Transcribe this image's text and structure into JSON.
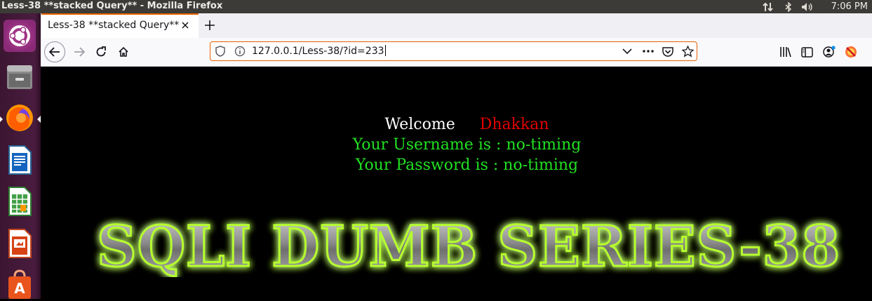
{
  "top_panel": {
    "window_title": "Less-38 **stacked Query** - Mozilla Firefox",
    "clock": "7:06 PM"
  },
  "launcher": {
    "items": [
      "ubuntu-dash",
      "files",
      "firefox",
      "libreoffice-writer",
      "libreoffice-calc",
      "libreoffice-impress",
      "ubuntu-software"
    ]
  },
  "browser": {
    "tab": {
      "label": "Less-38 **stacked Query**"
    },
    "url": "127.0.0.1/Less-38/?id=233"
  },
  "page": {
    "welcome_word": "Welcome",
    "welcome_name": "Dhakkan",
    "username_line": "Your Username is : no-timing",
    "password_line": "Your Password is : no-timing",
    "banner_text": "SQLI DUMB SERIES-38"
  },
  "colors": {
    "accent": "#e66000",
    "welcome_name": "#e10000",
    "info_text": "#22e022",
    "banner_glow": "#b6ff2e"
  }
}
